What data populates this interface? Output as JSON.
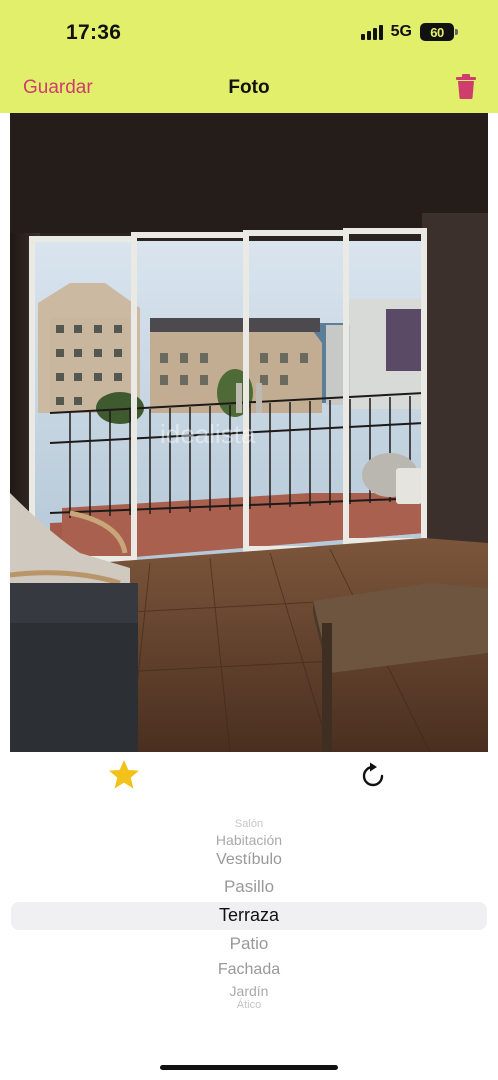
{
  "status_bar": {
    "time": "17:36",
    "network": "5G",
    "battery": "60"
  },
  "nav": {
    "save_label": "Guardar",
    "title": "Foto",
    "delete_icon": "trash-icon",
    "accent_color": "#cf3d6e",
    "bar_color": "#e2ef6b"
  },
  "photo": {
    "watermark": "idealista"
  },
  "actions": {
    "favorite_icon": "star-icon",
    "favorite_color": "#f2c21b",
    "rotate_icon": "rotate-icon"
  },
  "room_picker": {
    "options": [
      "Salón",
      "Habitación",
      "Vestíbulo",
      "Pasillo",
      "Terraza",
      "Patio",
      "Fachada",
      "Jardín",
      "Ático"
    ],
    "selected": "Terraza"
  }
}
